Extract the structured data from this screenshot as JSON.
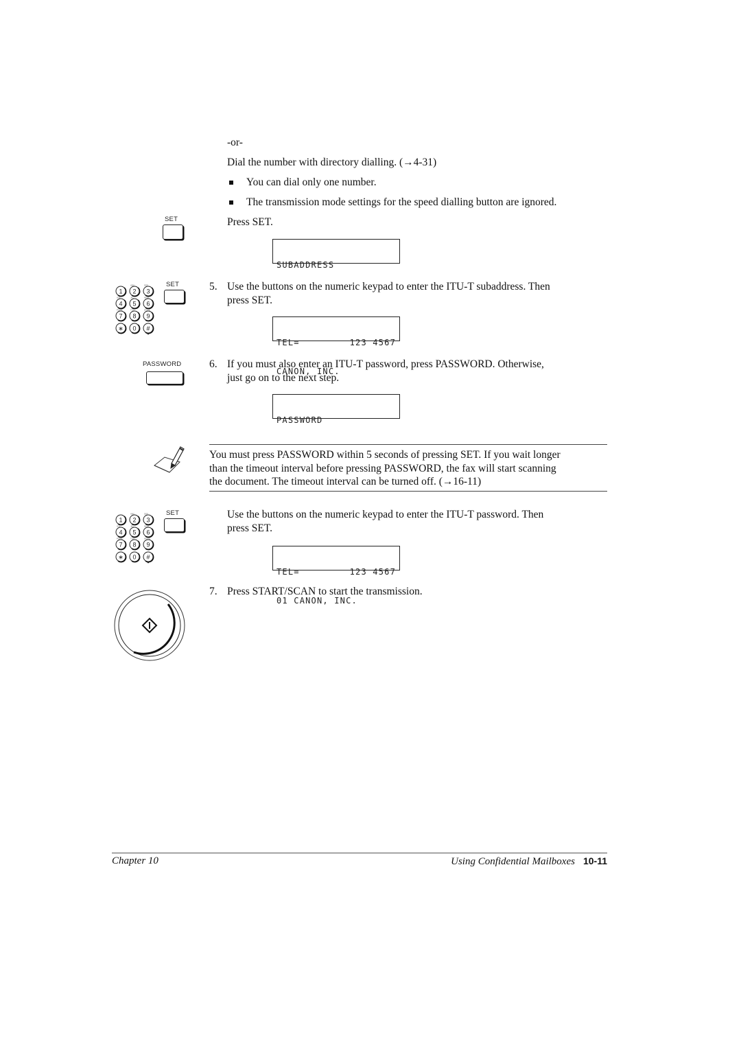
{
  "intro": {
    "or_label": "-or-",
    "directory_text": "Dial the number with directory dialling. (→4-31)",
    "bullets": [
      "You can dial only one number.",
      "The transmission mode settings for the speed dialling button are ignored."
    ],
    "press_set": "Press SET.",
    "lcd_subaddress": "SUBADDRESS"
  },
  "buttons": {
    "set_label": "SET",
    "password_label": "PASSWORD"
  },
  "keypad": {
    "keys": [
      "1",
      "2",
      "3",
      "4",
      "5",
      "6",
      "7",
      "8",
      "9",
      "∗",
      "0",
      "#"
    ],
    "sublabels": [
      "",
      "ABC",
      "DEF",
      "GHI",
      "JKL",
      "MNO",
      "PQRS",
      "TUV",
      "WXYZ",
      "",
      "",
      ""
    ]
  },
  "steps": [
    {
      "number": "5.",
      "line1": "Use the buttons on the numeric keypad to enter the ITU-T subaddress. Then",
      "line2": "press SET.",
      "lcd_row1_left": "TEL=",
      "lcd_row1_right": "123 4567",
      "lcd_row2": "CANON, INC."
    },
    {
      "number": "6.",
      "line1": "If you must also enter an ITU-T password, press PASSWORD. Otherwise,",
      "line2": "just go on to the next step.",
      "lcd_row1": "PASSWORD"
    },
    {
      "number": "",
      "line1": "Use the buttons on the numeric keypad to enter the ITU-T password. Then",
      "line2": "press SET.",
      "lcd_row1_left": "TEL=",
      "lcd_row1_right": "123 4567",
      "lcd_row2": "01 CANON, INC."
    },
    {
      "number": "7.",
      "line1": "Press START/SCAN to start the transmission."
    }
  ],
  "note": {
    "icon": "note-pencil-icon",
    "lines": [
      "You must press PASSWORD within 5 seconds of pressing SET. If you wait longer",
      "than the timeout interval before pressing PASSWORD, the fax will start scanning",
      "the document. The timeout interval can be turned off. (→16-11)"
    ]
  },
  "footer": {
    "chapter": "Chapter 10",
    "section": "Using Confidential Mailboxes",
    "page": "10-11"
  }
}
